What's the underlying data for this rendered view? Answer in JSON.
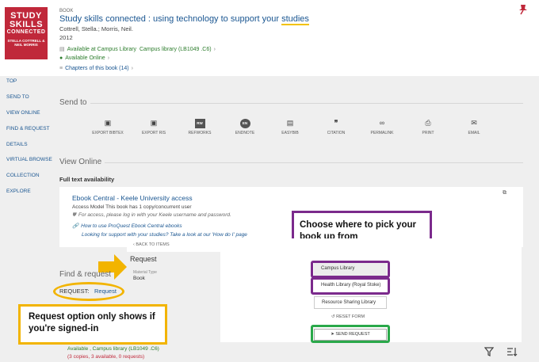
{
  "record": {
    "cover": {
      "line1": "STUDY",
      "line2": "SKILLS",
      "line3": "CONNECTED",
      "authors": "STELLA COTTRELL & NEIL MORRIS",
      "publisher": "palgrave"
    },
    "type": "BOOK",
    "title_start": "Study skills connected : using technology to support your ",
    "title_end": "studies",
    "authors": "Cottrell, Stella.; Morris, Neil.",
    "year": "2012",
    "available_at": "Available at Campus Library",
    "available_loc": "Campus library (LB1049 .C6)",
    "available_online": "Available Online",
    "chapters": "Chapters of this book (14)"
  },
  "nav": [
    "TOP",
    "SEND TO",
    "VIEW ONLINE",
    "FIND & REQUEST",
    "DETAILS",
    "VIRTUAL BROWSE",
    "COLLECTION",
    "EXPLORE"
  ],
  "send_to": {
    "heading": "Send to",
    "actions": [
      {
        "label": "EXPORT BIBTEX",
        "icon": "export-bibtex-icon"
      },
      {
        "label": "EXPORT RIS",
        "icon": "export-ris-icon"
      },
      {
        "label": "REFWORKS",
        "icon": "refworks-icon",
        "badge": "RW"
      },
      {
        "label": "ENDNOTE",
        "icon": "endnote-icon",
        "badge": "EN"
      },
      {
        "label": "EASYBIB",
        "icon": "easybib-icon"
      },
      {
        "label": "CITATION",
        "icon": "citation-icon"
      },
      {
        "label": "PERMALINK",
        "icon": "permalink-icon"
      },
      {
        "label": "PRINT",
        "icon": "print-icon"
      },
      {
        "label": "EMAIL",
        "icon": "email-icon"
      }
    ]
  },
  "view_online": {
    "heading": "View Online",
    "full_text": "Full text availability",
    "provider": "Ebook Central - Keele University access",
    "access_model": "Access Model This book has 1 copy/concurrent user",
    "access_note": "For access, please log in with your Keele username and password.",
    "how_to": "How to use ProQuest Ebook Central ebooks",
    "support": "Looking for support with your studies? Take a look at our 'How do I' page"
  },
  "find_request": {
    "heading": "Find & request",
    "request_label": "REQUEST:",
    "request_link": "Request"
  },
  "request_form": {
    "back": "BACK TO ITEMS",
    "heading": "Request",
    "material_type_label": "Material Type",
    "material_type_value": "Book",
    "pickup_options": [
      "Campus Library",
      "Health Library (Royal Stoke)",
      "Resource Sharing Library"
    ],
    "reset": "RESET FORM",
    "send": "SEND REQUEST"
  },
  "callouts": {
    "pickup": "Choose where to pick your book up from",
    "signin": "Request option only shows if you're signed-in"
  },
  "bottom": {
    "availability": "Available , Campus library (LB1049 .C6)",
    "copies": "(3 copies, 3 available, 0 requests)"
  },
  "colors": {
    "link": "#1a5691",
    "available": "#2d7d2d",
    "purple": "#7b2a8c",
    "yellow": "#f2b400",
    "green": "#2aa84a",
    "red": "#c0283a"
  }
}
